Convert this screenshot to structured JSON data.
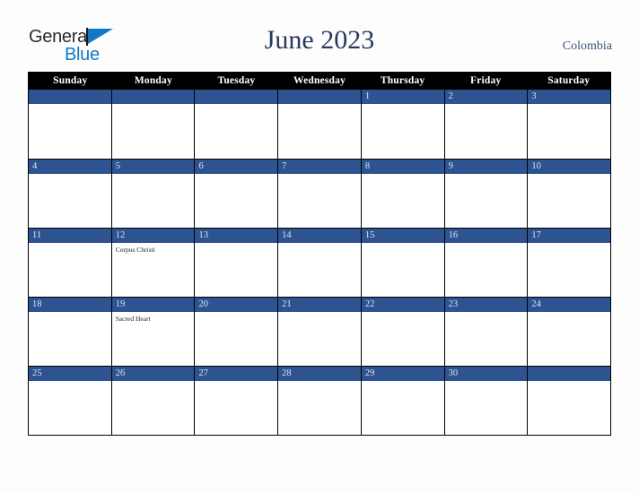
{
  "brand": {
    "name_part1": "General",
    "name_part2": "Blue",
    "triangle_color": "#1277c4"
  },
  "header": {
    "title": "June 2023",
    "region": "Colombia",
    "title_color": "#27395e",
    "region_color": "#3c5180"
  },
  "calendar": {
    "accent_color": "#2e5391",
    "header_bg": "#000000",
    "weekday_headers": [
      "Sunday",
      "Monday",
      "Tuesday",
      "Wednesday",
      "Thursday",
      "Friday",
      "Saturday"
    ],
    "weeks": [
      [
        {
          "date": "",
          "events": []
        },
        {
          "date": "",
          "events": []
        },
        {
          "date": "",
          "events": []
        },
        {
          "date": "",
          "events": []
        },
        {
          "date": "1",
          "events": []
        },
        {
          "date": "2",
          "events": []
        },
        {
          "date": "3",
          "events": []
        }
      ],
      [
        {
          "date": "4",
          "events": []
        },
        {
          "date": "5",
          "events": []
        },
        {
          "date": "6",
          "events": []
        },
        {
          "date": "7",
          "events": []
        },
        {
          "date": "8",
          "events": []
        },
        {
          "date": "9",
          "events": []
        },
        {
          "date": "10",
          "events": []
        }
      ],
      [
        {
          "date": "11",
          "events": []
        },
        {
          "date": "12",
          "events": [
            "Corpus Christi"
          ]
        },
        {
          "date": "13",
          "events": []
        },
        {
          "date": "14",
          "events": []
        },
        {
          "date": "15",
          "events": []
        },
        {
          "date": "16",
          "events": []
        },
        {
          "date": "17",
          "events": []
        }
      ],
      [
        {
          "date": "18",
          "events": []
        },
        {
          "date": "19",
          "events": [
            "Sacred Heart"
          ]
        },
        {
          "date": "20",
          "events": []
        },
        {
          "date": "21",
          "events": []
        },
        {
          "date": "22",
          "events": []
        },
        {
          "date": "23",
          "events": []
        },
        {
          "date": "24",
          "events": []
        }
      ],
      [
        {
          "date": "25",
          "events": []
        },
        {
          "date": "26",
          "events": []
        },
        {
          "date": "27",
          "events": []
        },
        {
          "date": "28",
          "events": []
        },
        {
          "date": "29",
          "events": []
        },
        {
          "date": "30",
          "events": []
        },
        {
          "date": "",
          "events": []
        }
      ]
    ]
  }
}
